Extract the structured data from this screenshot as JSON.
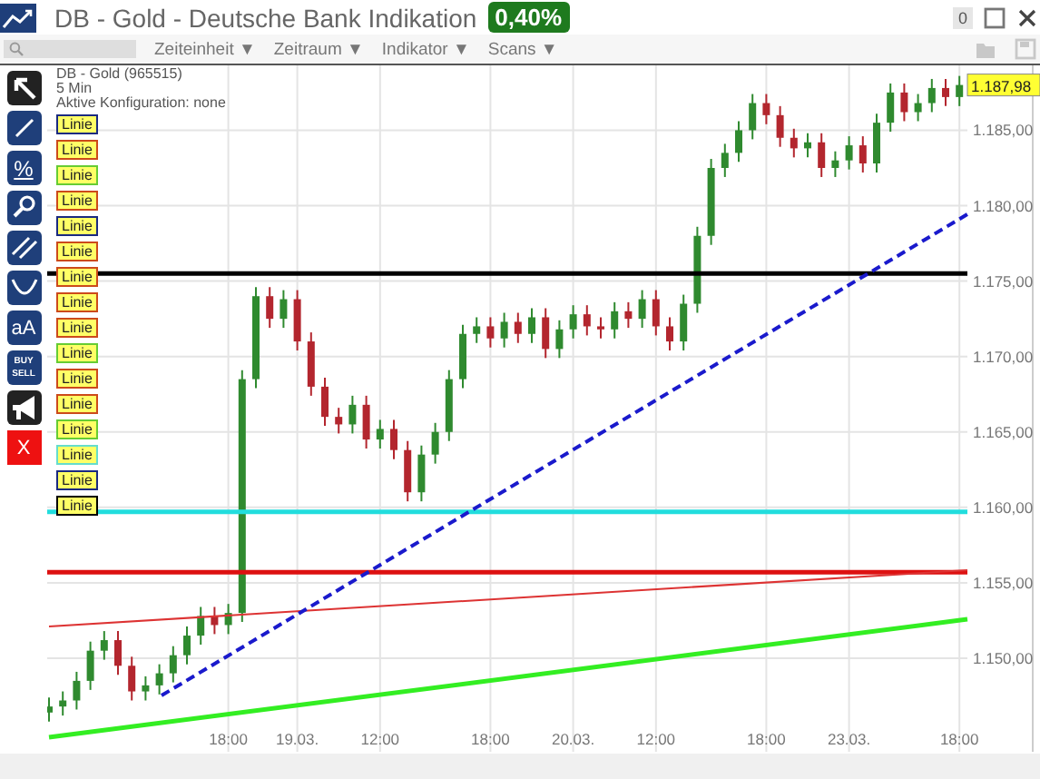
{
  "window": {
    "title": "DB - Gold - Deutsche Bank Indikation",
    "change_badge": "0,40%",
    "counter": "0"
  },
  "toolbar": {
    "menus": [
      {
        "label": "Zeiteinheit ▼"
      },
      {
        "label": "Zeitraum ▼"
      },
      {
        "label": "Indikator ▼"
      },
      {
        "label": "Scans ▼"
      }
    ],
    "actions": [
      {
        "kind": "folder",
        "disabled": true
      },
      {
        "kind": "save",
        "disabled": true
      }
    ]
  },
  "tools": [
    {
      "kind": "pointer"
    },
    {
      "kind": "line"
    },
    {
      "kind": "percent",
      "label": "%"
    },
    {
      "kind": "zoom"
    },
    {
      "kind": "parallel"
    },
    {
      "kind": "curve"
    },
    {
      "kind": "text",
      "label": "aA"
    },
    {
      "kind": "trade",
      "label": "BUY",
      "label_2": "SELL"
    },
    {
      "kind": "alert"
    },
    {
      "kind": "delete",
      "label": "X"
    }
  ],
  "chart": {
    "info": [
      "DB - Gold (965515)",
      "5 Min",
      "Aktive Konfiguration: none"
    ],
    "legend": [
      {
        "label": "Linie",
        "color": "#1a2a80"
      },
      {
        "label": "Linie",
        "color": "#cc4a1a"
      },
      {
        "label": "Linie",
        "color": "#66cc33"
      },
      {
        "label": "Linie",
        "color": "#cc4a1a"
      },
      {
        "label": "Linie",
        "color": "#1a2a80"
      },
      {
        "label": "Linie",
        "color": "#cc4a1a"
      },
      {
        "label": "Linie",
        "color": "#cc4a1a"
      },
      {
        "label": "Linie",
        "color": "#cc4a1a"
      },
      {
        "label": "Linie",
        "color": "#cc4a1a"
      },
      {
        "label": "Linie",
        "color": "#66cc33"
      },
      {
        "label": "Linie",
        "color": "#cc4a1a"
      },
      {
        "label": "Linie",
        "color": "#cc4a1a"
      },
      {
        "label": "Linie",
        "color": "#66cc33"
      },
      {
        "label": "Linie",
        "color": "#66ddcc"
      },
      {
        "label": "Linie",
        "color": "#1a2a80"
      },
      {
        "label": "Linie",
        "color": "#000000"
      }
    ],
    "last_price": "1.187,98",
    "chart_data": {
      "type": "candlestick",
      "ylim": [
        1143.8,
        1189.3
      ],
      "grid": true,
      "ref_lines": [
        {
          "axis": "y",
          "value": 1175.5,
          "color": "#000000"
        },
        {
          "axis": "y",
          "value": 1159.7,
          "color": "#22dddd"
        },
        {
          "axis": "y",
          "value": 1155.7,
          "color": "#dd1111"
        }
      ],
      "categories": [
        null,
        null,
        null,
        null,
        null,
        null,
        null,
        null,
        null,
        null,
        null,
        null,
        null,
        "18:00",
        null,
        null,
        null,
        null,
        "19.03.",
        null,
        null,
        null,
        null,
        null,
        "12:00",
        null,
        null,
        null,
        null,
        null,
        null,
        null,
        "18:00",
        null,
        null,
        null,
        null,
        null,
        "20.03.",
        null,
        null,
        null,
        null,
        null,
        "12:00",
        null,
        null,
        null,
        null,
        null,
        null,
        null,
        "18:00",
        null,
        null,
        null,
        null,
        null,
        "23.03.",
        null,
        null,
        null,
        null,
        null,
        null,
        null,
        "18:00"
      ],
      "ohlc": [
        [
          1146.4,
          1147.4,
          1145.8,
          1146.8
        ],
        [
          1146.8,
          1147.8,
          1146.2,
          1147.2
        ],
        [
          1147.2,
          1149.1,
          1146.6,
          1148.5
        ],
        [
          1148.5,
          1151.1,
          1147.9,
          1150.5
        ],
        [
          1150.5,
          1151.8,
          1149.9,
          1151.2
        ],
        [
          1151.2,
          1151.8,
          1148.9,
          1149.5
        ],
        [
          1149.5,
          1150.1,
          1147.2,
          1147.8
        ],
        [
          1147.8,
          1148.8,
          1147.2,
          1148.2
        ],
        [
          1148.2,
          1149.6,
          1147.6,
          1149.0
        ],
        [
          1149.0,
          1150.8,
          1148.4,
          1150.2
        ],
        [
          1150.2,
          1152.1,
          1149.6,
          1151.5
        ],
        [
          1151.5,
          1153.4,
          1150.9,
          1152.8
        ],
        [
          1152.8,
          1153.4,
          1151.6,
          1152.2
        ],
        [
          1152.2,
          1153.6,
          1151.6,
          1153.0
        ],
        [
          1153.0,
          1169.1,
          1152.4,
          1168.5
        ],
        [
          1168.5,
          1174.6,
          1167.9,
          1174.0
        ],
        [
          1174.0,
          1174.6,
          1171.9,
          1172.5
        ],
        [
          1172.5,
          1174.4,
          1171.9,
          1173.8
        ],
        [
          1173.8,
          1174.4,
          1170.4,
          1171.0
        ],
        [
          1171.0,
          1171.6,
          1167.4,
          1168.0
        ],
        [
          1168.0,
          1168.6,
          1165.4,
          1166.0
        ],
        [
          1166.0,
          1166.6,
          1164.9,
          1165.5
        ],
        [
          1165.5,
          1167.4,
          1164.9,
          1166.8
        ],
        [
          1166.8,
          1167.4,
          1163.9,
          1164.5
        ],
        [
          1164.5,
          1165.8,
          1163.9,
          1165.2
        ],
        [
          1165.2,
          1165.8,
          1163.2,
          1163.8
        ],
        [
          1163.8,
          1164.4,
          1160.4,
          1161.0
        ],
        [
          1161.0,
          1164.1,
          1160.4,
          1163.5
        ],
        [
          1163.5,
          1165.6,
          1162.9,
          1165.0
        ],
        [
          1165.0,
          1169.1,
          1164.4,
          1168.5
        ],
        [
          1168.5,
          1172.1,
          1167.9,
          1171.5
        ],
        [
          1171.5,
          1172.6,
          1170.9,
          1172.0
        ],
        [
          1172.0,
          1172.6,
          1170.6,
          1171.2
        ],
        [
          1171.2,
          1172.9,
          1170.6,
          1172.3
        ],
        [
          1172.3,
          1172.9,
          1170.9,
          1171.5
        ],
        [
          1171.5,
          1173.2,
          1170.9,
          1172.6
        ],
        [
          1172.6,
          1173.2,
          1169.9,
          1170.5
        ],
        [
          1170.5,
          1172.4,
          1169.9,
          1171.8
        ],
        [
          1171.8,
          1173.4,
          1171.2,
          1172.8
        ],
        [
          1172.8,
          1173.4,
          1171.4,
          1172.0
        ],
        [
          1172.0,
          1172.6,
          1171.2,
          1171.8
        ],
        [
          1171.8,
          1173.6,
          1171.2,
          1173.0
        ],
        [
          1173.0,
          1173.6,
          1171.9,
          1172.5
        ],
        [
          1172.5,
          1174.4,
          1171.9,
          1173.8
        ],
        [
          1173.8,
          1174.4,
          1171.4,
          1172.0
        ],
        [
          1172.0,
          1172.6,
          1170.4,
          1171.0
        ],
        [
          1171.0,
          1174.1,
          1170.4,
          1173.5
        ],
        [
          1173.5,
          1178.6,
          1172.9,
          1178.0
        ],
        [
          1178.0,
          1183.1,
          1177.4,
          1182.5
        ],
        [
          1182.5,
          1184.1,
          1181.9,
          1183.5
        ],
        [
          1183.5,
          1185.6,
          1182.9,
          1185.0
        ],
        [
          1185.0,
          1187.4,
          1184.4,
          1186.8
        ],
        [
          1186.8,
          1187.4,
          1185.4,
          1186.0
        ],
        [
          1186.0,
          1186.6,
          1183.9,
          1184.5
        ],
        [
          1184.5,
          1185.1,
          1183.2,
          1183.8
        ],
        [
          1183.8,
          1184.8,
          1183.2,
          1184.2
        ],
        [
          1184.2,
          1184.8,
          1181.9,
          1182.5
        ],
        [
          1182.5,
          1183.6,
          1181.9,
          1183.0
        ],
        [
          1183.0,
          1184.6,
          1182.4,
          1184.0
        ],
        [
          1184.0,
          1184.6,
          1182.2,
          1182.8
        ],
        [
          1182.8,
          1186.1,
          1182.2,
          1185.5
        ],
        [
          1185.5,
          1188.1,
          1184.9,
          1187.5
        ],
        [
          1187.5,
          1188.1,
          1185.6,
          1186.2
        ],
        [
          1186.2,
          1187.4,
          1185.6,
          1186.8
        ],
        [
          1186.8,
          1188.4,
          1186.2,
          1187.8
        ],
        [
          1187.8,
          1188.4,
          1186.6,
          1187.2
        ],
        [
          1187.2,
          1188.6,
          1186.6,
          1188.0
        ]
      ],
      "yticks": [
        {
          "value": 1150,
          "label": "1.150,00"
        },
        {
          "value": 1155,
          "label": "1.155,00"
        },
        {
          "value": 1160,
          "label": "1.160,00"
        },
        {
          "value": 1165,
          "label": "1.165,00"
        },
        {
          "value": 1170,
          "label": "1.170,00"
        },
        {
          "value": 1175,
          "label": "1.175,00"
        },
        {
          "value": 1180,
          "label": "1.180,00"
        },
        {
          "value": 1185,
          "label": "1.185,00"
        }
      ]
    }
  }
}
